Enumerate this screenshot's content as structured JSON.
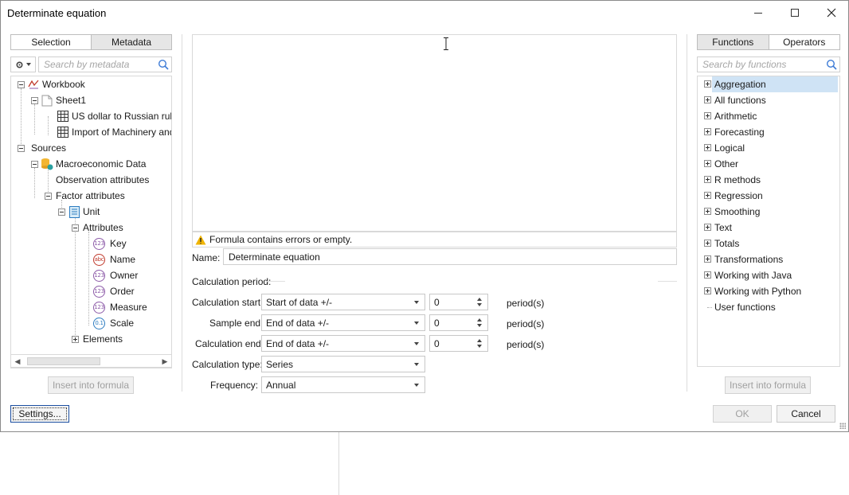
{
  "window": {
    "title": "Determinate equation"
  },
  "left_panel": {
    "tabs": [
      "Selection",
      "Metadata"
    ],
    "search_placeholder": "Search by metadata",
    "tree": {
      "workbook": "Workbook",
      "sheet1": "Sheet1",
      "table1": "US dollar to Russian rubl",
      "table2": "Import of Machinery and",
      "sources": "Sources",
      "macro": "Macroeconomic Data",
      "observation": "Observation attributes",
      "factor": "Factor attributes",
      "unit": "Unit",
      "attributes": "Attributes",
      "attr_items": [
        {
          "icon": "123",
          "label": "Key"
        },
        {
          "icon": "abc",
          "label": "Name"
        },
        {
          "icon": "123",
          "label": "Owner"
        },
        {
          "icon": "123",
          "label": "Order"
        },
        {
          "icon": "123",
          "label": "Measure"
        },
        {
          "icon": "0.1",
          "label": "Scale"
        }
      ],
      "elements": "Elements"
    },
    "insert_button": "Insert into formula"
  },
  "center": {
    "status_text": "Formula contains errors or empty.",
    "name_label": "Name:",
    "name_value": "Determinate equation",
    "calc_period_label": "Calculation period:",
    "calc_start_label": "Calculation start:",
    "calc_start_value": "Start of data +/-",
    "calc_start_offset": "0",
    "sample_end_label": "Sample end:",
    "sample_end_value": "End of data +/-",
    "sample_end_offset": "0",
    "calc_end_label": "Calculation end:",
    "calc_end_value": "End of data +/-",
    "calc_end_offset": "0",
    "periods_unit": "period(s)",
    "calc_type_label": "Calculation type:",
    "calc_type_value": "Series",
    "frequency_label": "Frequency:",
    "frequency_value": "Annual"
  },
  "right_panel": {
    "tabs": [
      "Functions",
      "Operators"
    ],
    "search_placeholder": "Search by functions",
    "functions": [
      "Aggregation",
      "All functions",
      "Arithmetic",
      "Forecasting",
      "Logical",
      "Other",
      "R methods",
      "Regression",
      "Smoothing",
      "Text",
      "Totals",
      "Transformations",
      "Working with Java",
      "Working with Python"
    ],
    "user_functions": "User functions",
    "insert_button": "Insert into formula"
  },
  "footer": {
    "settings": "Settings...",
    "ok": "OK",
    "cancel": "Cancel"
  }
}
